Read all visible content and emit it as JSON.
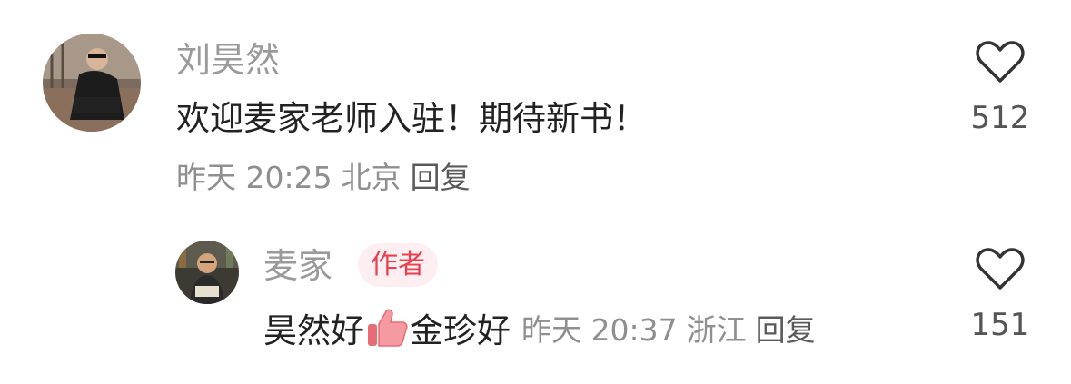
{
  "comment": {
    "username": "刘昊然",
    "text": "欢迎麦家老师入驻！期待新书！",
    "time": "昨天 20:25",
    "location": "北京",
    "reply_label": "回复",
    "like_count": "512",
    "avatar_icon": "person-sitting-avatar"
  },
  "reply": {
    "username": "麦家",
    "badge": "作者",
    "text_part1": "昊然好",
    "emoji_icon": "thumbs-up-emoji",
    "text_part2": "金珍好",
    "time": "昨天 20:37",
    "location": "浙江",
    "reply_label": "回复",
    "like_count": "151",
    "avatar_icon": "person-reading-avatar"
  },
  "colors": {
    "badge_text": "#e8404f",
    "badge_bg": "#fdeff1",
    "username": "#9a9a9a",
    "meta": "#8f8f8f"
  }
}
